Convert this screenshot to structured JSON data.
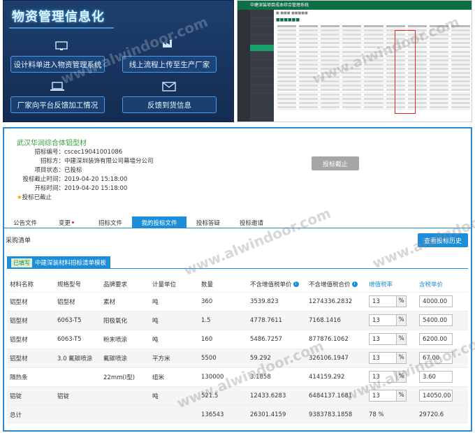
{
  "banner": {
    "title": "物资管理信息化",
    "features": [
      "设计料单进入物资管理系统",
      "线上流程上传至生产厂家",
      "厂家向平台反馈加工情况",
      "反馈到货信息"
    ],
    "icons": [
      "monitor-icon",
      "factory-icon",
      "laptop-icon",
      "envelope-icon"
    ]
  },
  "app_preview": {
    "title": "中建深装项目成本综合管理系统"
  },
  "watermark": "www.alwindoor.com",
  "project": {
    "name": "武汉华润综合体铝型材",
    "fields": [
      {
        "label": "招标编号：",
        "value": "cscec19041001086"
      },
      {
        "label": "招标方：",
        "value": "中建深圳装饰有限公司幕墙分公司"
      },
      {
        "label": "项目状态：",
        "value": "已投标"
      },
      {
        "label": "投标截止时间：",
        "value": "2019-04-20 15:18:00"
      },
      {
        "label": "开标时间：",
        "value": "2019-04-20 15:18:00"
      }
    ],
    "status": "投标已截止",
    "bid_button": "投标截止"
  },
  "tabs": [
    {
      "label": "公告文件",
      "active": false
    },
    {
      "label": "变更",
      "active": false,
      "dot": true
    },
    {
      "label": "招标文件",
      "active": false
    },
    {
      "label": "我的投标文件",
      "active": true
    },
    {
      "label": "投标答疑",
      "active": false
    },
    {
      "label": "投标邀请",
      "active": false
    }
  ],
  "purchase": {
    "title": "采购清单",
    "history_button": "查看投标历史",
    "filled_tag": "已填写",
    "template_tab": "中建深装材料招标清单模板"
  },
  "table": {
    "headers": [
      "材料名称",
      "规格型号",
      "品牌要求",
      "计量单位",
      "数量",
      "不含增值税单价",
      "不含增值税合价",
      "增值税率",
      "含税单价"
    ],
    "rows": [
      [
        "铝型材",
        "铝型材",
        "素材",
        "吨",
        "360",
        "3539.823",
        "1274336.2832",
        "13",
        "4000.00"
      ],
      [
        "铝型材",
        "6063-T5",
        "阳极氧化",
        "吨",
        "1.5",
        "4778.7611",
        "7168.1416",
        "13",
        "5400.00"
      ],
      [
        "铝型材",
        "6063-T5",
        "粉末喷涂",
        "吨",
        "160",
        "5486.7257",
        "877876.1062",
        "13",
        "6200.00"
      ],
      [
        "铝型材",
        "3.0 氟碳喷涂",
        "氟碳喷涂",
        "平方米",
        "5500",
        "59.292",
        "326106.1947",
        "13",
        "67.00"
      ],
      [
        "隔热条",
        "",
        "22mm(I型)",
        "组米",
        "130000",
        "3.1858",
        "414159.292",
        "13",
        "3.60"
      ],
      [
        "铝锭",
        "铝锭",
        "",
        "吨",
        "521.5",
        "12433.6283",
        "6484137.1681",
        "13",
        "14050.00"
      ]
    ],
    "total": {
      "label": "总计",
      "qty": "136543",
      "unit_price": "26301.4159",
      "amount": "9383783.1858",
      "rate": "78 %",
      "tax_price": "29720.6"
    },
    "pct": "%"
  }
}
